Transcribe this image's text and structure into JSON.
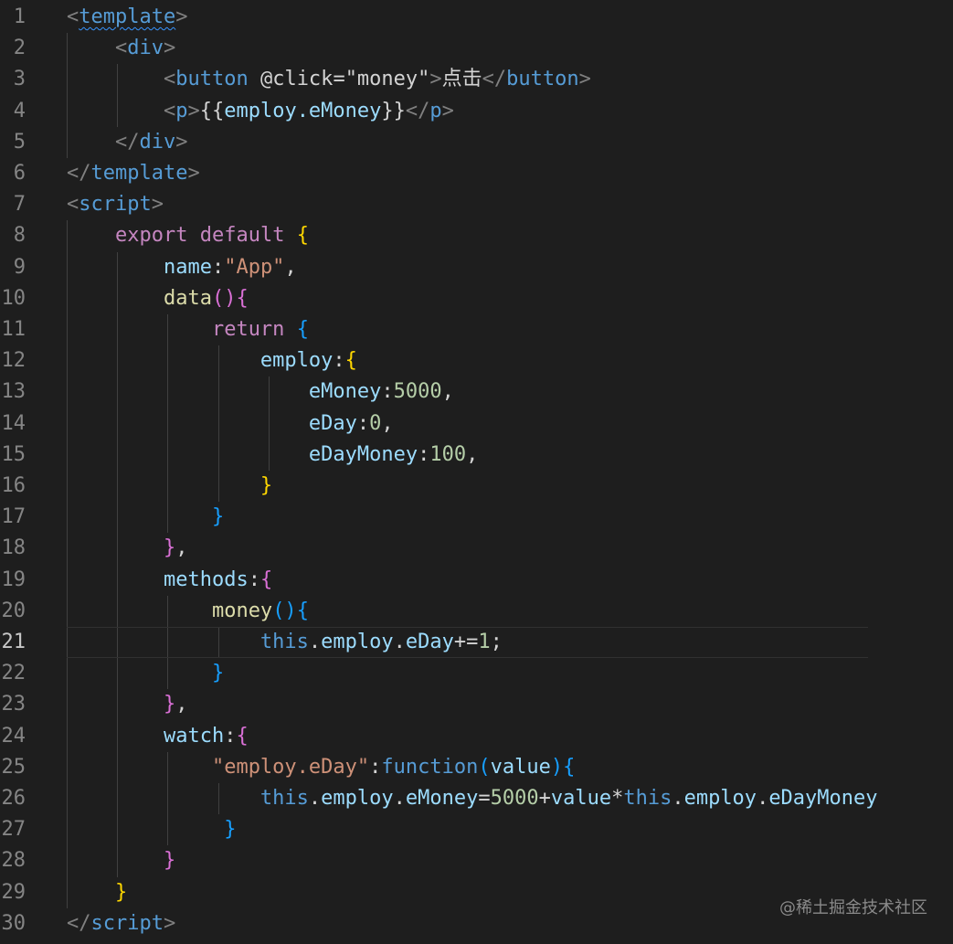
{
  "editor": {
    "active_line": 21,
    "colors": {
      "background": "#1e1e1e",
      "line_number": "#858585",
      "line_number_active": "#c6c6c6",
      "tag_bracket": "#808080",
      "tag_name": "#569cd6",
      "attribute": "#9cdcfe",
      "string": "#ce9178",
      "keyword_control": "#c586c0",
      "keyword": "#569cd6",
      "function": "#dcdcaa",
      "property": "#9cdcfe",
      "number": "#b5cea8",
      "text": "#d4d4d4",
      "bracket_gold": "#ffd700",
      "bracket_pink": "#da70d6",
      "bracket_blue": "#179fff"
    },
    "lines": [
      {
        "n": 1,
        "tokens": [
          [
            "<",
            "tag_bracket"
          ],
          [
            "template",
            "tag_name",
            "squiggle"
          ],
          [
            ">",
            "tag_bracket"
          ]
        ]
      },
      {
        "n": 2,
        "tokens": [
          [
            "    ",
            "text"
          ],
          [
            "<",
            "tag_bracket"
          ],
          [
            "div",
            "tag_name"
          ],
          [
            ">",
            "tag_bracket"
          ]
        ]
      },
      {
        "n": 3,
        "tokens": [
          [
            "        ",
            "text"
          ],
          [
            "<",
            "tag_bracket"
          ],
          [
            "button",
            "tag_name"
          ],
          [
            " ",
            "text"
          ],
          [
            "@click",
            "text"
          ],
          [
            "=",
            "text"
          ],
          [
            "\"money\"",
            "text"
          ],
          [
            ">",
            "tag_bracket"
          ],
          [
            "点击",
            "text"
          ],
          [
            "</",
            "tag_bracket"
          ],
          [
            "button",
            "tag_name"
          ],
          [
            ">",
            "tag_bracket"
          ]
        ]
      },
      {
        "n": 4,
        "tokens": [
          [
            "        ",
            "text"
          ],
          [
            "<",
            "tag_bracket"
          ],
          [
            "p",
            "tag_name"
          ],
          [
            ">",
            "tag_bracket"
          ],
          [
            "{{",
            "text"
          ],
          [
            "employ.eMoney",
            "property"
          ],
          [
            "}}",
            "text"
          ],
          [
            "</",
            "tag_bracket"
          ],
          [
            "p",
            "tag_name"
          ],
          [
            ">",
            "tag_bracket"
          ]
        ]
      },
      {
        "n": 5,
        "tokens": [
          [
            "    ",
            "text"
          ],
          [
            "</",
            "tag_bracket"
          ],
          [
            "div",
            "tag_name"
          ],
          [
            ">",
            "tag_bracket"
          ]
        ]
      },
      {
        "n": 6,
        "tokens": [
          [
            "</",
            "tag_bracket"
          ],
          [
            "template",
            "tag_name"
          ],
          [
            ">",
            "tag_bracket"
          ]
        ]
      },
      {
        "n": 7,
        "tokens": [
          [
            "<",
            "tag_bracket"
          ],
          [
            "script",
            "tag_name"
          ],
          [
            ">",
            "tag_bracket"
          ]
        ]
      },
      {
        "n": 8,
        "tokens": [
          [
            "    ",
            "text"
          ],
          [
            "export",
            "keyword_control"
          ],
          [
            " ",
            "text"
          ],
          [
            "default",
            "keyword_control"
          ],
          [
            " ",
            "text"
          ],
          [
            "{",
            "bracket_gold"
          ]
        ]
      },
      {
        "n": 9,
        "tokens": [
          [
            "        ",
            "text"
          ],
          [
            "name",
            "property"
          ],
          [
            ":",
            "text"
          ],
          [
            "\"App\"",
            "string"
          ],
          [
            ",",
            "text"
          ]
        ]
      },
      {
        "n": 10,
        "tokens": [
          [
            "        ",
            "text"
          ],
          [
            "data",
            "function"
          ],
          [
            "()",
            "bracket_pink"
          ],
          [
            "{",
            "bracket_pink"
          ]
        ]
      },
      {
        "n": 11,
        "tokens": [
          [
            "            ",
            "text"
          ],
          [
            "return",
            "keyword_control"
          ],
          [
            " ",
            "text"
          ],
          [
            "{",
            "bracket_blue"
          ]
        ]
      },
      {
        "n": 12,
        "tokens": [
          [
            "                ",
            "text"
          ],
          [
            "employ",
            "property"
          ],
          [
            ":",
            "text"
          ],
          [
            "{",
            "bracket_gold"
          ]
        ]
      },
      {
        "n": 13,
        "tokens": [
          [
            "                    ",
            "text"
          ],
          [
            "eMoney",
            "property"
          ],
          [
            ":",
            "text"
          ],
          [
            "5000",
            "number"
          ],
          [
            ",",
            "text"
          ]
        ]
      },
      {
        "n": 14,
        "tokens": [
          [
            "                    ",
            "text"
          ],
          [
            "eDay",
            "property"
          ],
          [
            ":",
            "text"
          ],
          [
            "0",
            "number"
          ],
          [
            ",",
            "text"
          ]
        ]
      },
      {
        "n": 15,
        "tokens": [
          [
            "                    ",
            "text"
          ],
          [
            "eDayMoney",
            "property"
          ],
          [
            ":",
            "text"
          ],
          [
            "100",
            "number"
          ],
          [
            ",",
            "text"
          ]
        ]
      },
      {
        "n": 16,
        "tokens": [
          [
            "                ",
            "text"
          ],
          [
            "}",
            "bracket_gold"
          ]
        ]
      },
      {
        "n": 17,
        "tokens": [
          [
            "            ",
            "text"
          ],
          [
            "}",
            "bracket_blue"
          ]
        ]
      },
      {
        "n": 18,
        "tokens": [
          [
            "        ",
            "text"
          ],
          [
            "}",
            "bracket_pink"
          ],
          [
            ",",
            "text"
          ]
        ]
      },
      {
        "n": 19,
        "tokens": [
          [
            "        ",
            "text"
          ],
          [
            "methods",
            "property"
          ],
          [
            ":",
            "text"
          ],
          [
            "{",
            "bracket_pink"
          ]
        ]
      },
      {
        "n": 20,
        "tokens": [
          [
            "            ",
            "text"
          ],
          [
            "money",
            "function"
          ],
          [
            "()",
            "bracket_blue"
          ],
          [
            "{",
            "bracket_blue"
          ]
        ]
      },
      {
        "n": 21,
        "tokens": [
          [
            "                ",
            "text"
          ],
          [
            "this",
            "keyword"
          ],
          [
            ".",
            "text"
          ],
          [
            "employ",
            "property"
          ],
          [
            ".",
            "text"
          ],
          [
            "eDay",
            "property"
          ],
          [
            "+=",
            "text"
          ],
          [
            "1",
            "number"
          ],
          [
            ";",
            "text"
          ]
        ]
      },
      {
        "n": 22,
        "tokens": [
          [
            "            ",
            "text"
          ],
          [
            "}",
            "bracket_blue"
          ]
        ]
      },
      {
        "n": 23,
        "tokens": [
          [
            "        ",
            "text"
          ],
          [
            "}",
            "bracket_pink"
          ],
          [
            ",",
            "text"
          ]
        ]
      },
      {
        "n": 24,
        "tokens": [
          [
            "        ",
            "text"
          ],
          [
            "watch",
            "property"
          ],
          [
            ":",
            "text"
          ],
          [
            "{",
            "bracket_pink"
          ]
        ]
      },
      {
        "n": 25,
        "tokens": [
          [
            "            ",
            "text"
          ],
          [
            "\"employ.eDay\"",
            "string"
          ],
          [
            ":",
            "text"
          ],
          [
            "function",
            "keyword"
          ],
          [
            "(",
            "bracket_blue"
          ],
          [
            "value",
            "property"
          ],
          [
            ")",
            "bracket_blue"
          ],
          [
            "{",
            "bracket_blue"
          ]
        ]
      },
      {
        "n": 26,
        "tokens": [
          [
            "                ",
            "text"
          ],
          [
            "this",
            "keyword"
          ],
          [
            ".",
            "text"
          ],
          [
            "employ",
            "property"
          ],
          [
            ".",
            "text"
          ],
          [
            "eMoney",
            "property"
          ],
          [
            "=",
            "text"
          ],
          [
            "5000",
            "number"
          ],
          [
            "+",
            "text"
          ],
          [
            "value",
            "property"
          ],
          [
            "*",
            "text"
          ],
          [
            "this",
            "keyword"
          ],
          [
            ".",
            "text"
          ],
          [
            "employ",
            "property"
          ],
          [
            ".",
            "text"
          ],
          [
            "eDayMoney",
            "property"
          ]
        ]
      },
      {
        "n": 27,
        "tokens": [
          [
            "             ",
            "text"
          ],
          [
            "}",
            "bracket_blue"
          ]
        ]
      },
      {
        "n": 28,
        "tokens": [
          [
            "        ",
            "text"
          ],
          [
            "}",
            "bracket_pink"
          ]
        ]
      },
      {
        "n": 29,
        "tokens": [
          [
            "    ",
            "text"
          ],
          [
            "}",
            "bracket_gold"
          ]
        ]
      },
      {
        "n": 30,
        "tokens": [
          [
            "</",
            "tag_bracket"
          ],
          [
            "script",
            "tag_name"
          ],
          [
            ">",
            "tag_bracket"
          ]
        ]
      }
    ]
  },
  "watermark": "@稀土掘金技术社区"
}
